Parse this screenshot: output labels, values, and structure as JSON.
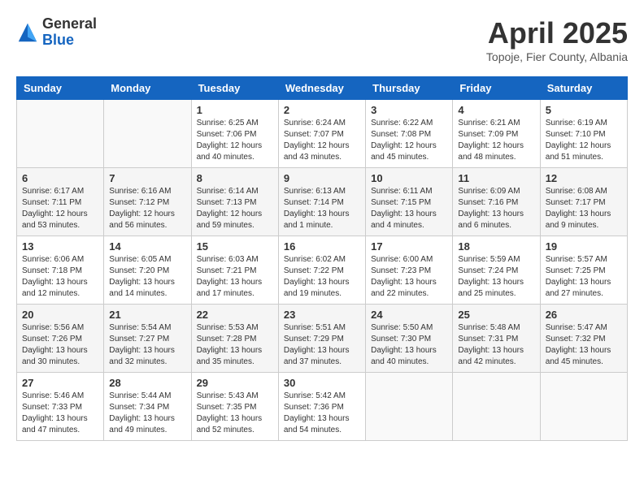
{
  "header": {
    "logo_general": "General",
    "logo_blue": "Blue",
    "month_year": "April 2025",
    "location": "Topoje, Fier County, Albania"
  },
  "days_of_week": [
    "Sunday",
    "Monday",
    "Tuesday",
    "Wednesday",
    "Thursday",
    "Friday",
    "Saturday"
  ],
  "weeks": [
    [
      {
        "day": "",
        "sunrise": "",
        "sunset": "",
        "daylight": ""
      },
      {
        "day": "",
        "sunrise": "",
        "sunset": "",
        "daylight": ""
      },
      {
        "day": "1",
        "sunrise": "Sunrise: 6:25 AM",
        "sunset": "Sunset: 7:06 PM",
        "daylight": "Daylight: 12 hours and 40 minutes."
      },
      {
        "day": "2",
        "sunrise": "Sunrise: 6:24 AM",
        "sunset": "Sunset: 7:07 PM",
        "daylight": "Daylight: 12 hours and 43 minutes."
      },
      {
        "day": "3",
        "sunrise": "Sunrise: 6:22 AM",
        "sunset": "Sunset: 7:08 PM",
        "daylight": "Daylight: 12 hours and 45 minutes."
      },
      {
        "day": "4",
        "sunrise": "Sunrise: 6:21 AM",
        "sunset": "Sunset: 7:09 PM",
        "daylight": "Daylight: 12 hours and 48 minutes."
      },
      {
        "day": "5",
        "sunrise": "Sunrise: 6:19 AM",
        "sunset": "Sunset: 7:10 PM",
        "daylight": "Daylight: 12 hours and 51 minutes."
      }
    ],
    [
      {
        "day": "6",
        "sunrise": "Sunrise: 6:17 AM",
        "sunset": "Sunset: 7:11 PM",
        "daylight": "Daylight: 12 hours and 53 minutes."
      },
      {
        "day": "7",
        "sunrise": "Sunrise: 6:16 AM",
        "sunset": "Sunset: 7:12 PM",
        "daylight": "Daylight: 12 hours and 56 minutes."
      },
      {
        "day": "8",
        "sunrise": "Sunrise: 6:14 AM",
        "sunset": "Sunset: 7:13 PM",
        "daylight": "Daylight: 12 hours and 59 minutes."
      },
      {
        "day": "9",
        "sunrise": "Sunrise: 6:13 AM",
        "sunset": "Sunset: 7:14 PM",
        "daylight": "Daylight: 13 hours and 1 minute."
      },
      {
        "day": "10",
        "sunrise": "Sunrise: 6:11 AM",
        "sunset": "Sunset: 7:15 PM",
        "daylight": "Daylight: 13 hours and 4 minutes."
      },
      {
        "day": "11",
        "sunrise": "Sunrise: 6:09 AM",
        "sunset": "Sunset: 7:16 PM",
        "daylight": "Daylight: 13 hours and 6 minutes."
      },
      {
        "day": "12",
        "sunrise": "Sunrise: 6:08 AM",
        "sunset": "Sunset: 7:17 PM",
        "daylight": "Daylight: 13 hours and 9 minutes."
      }
    ],
    [
      {
        "day": "13",
        "sunrise": "Sunrise: 6:06 AM",
        "sunset": "Sunset: 7:18 PM",
        "daylight": "Daylight: 13 hours and 12 minutes."
      },
      {
        "day": "14",
        "sunrise": "Sunrise: 6:05 AM",
        "sunset": "Sunset: 7:20 PM",
        "daylight": "Daylight: 13 hours and 14 minutes."
      },
      {
        "day": "15",
        "sunrise": "Sunrise: 6:03 AM",
        "sunset": "Sunset: 7:21 PM",
        "daylight": "Daylight: 13 hours and 17 minutes."
      },
      {
        "day": "16",
        "sunrise": "Sunrise: 6:02 AM",
        "sunset": "Sunset: 7:22 PM",
        "daylight": "Daylight: 13 hours and 19 minutes."
      },
      {
        "day": "17",
        "sunrise": "Sunrise: 6:00 AM",
        "sunset": "Sunset: 7:23 PM",
        "daylight": "Daylight: 13 hours and 22 minutes."
      },
      {
        "day": "18",
        "sunrise": "Sunrise: 5:59 AM",
        "sunset": "Sunset: 7:24 PM",
        "daylight": "Daylight: 13 hours and 25 minutes."
      },
      {
        "day": "19",
        "sunrise": "Sunrise: 5:57 AM",
        "sunset": "Sunset: 7:25 PM",
        "daylight": "Daylight: 13 hours and 27 minutes."
      }
    ],
    [
      {
        "day": "20",
        "sunrise": "Sunrise: 5:56 AM",
        "sunset": "Sunset: 7:26 PM",
        "daylight": "Daylight: 13 hours and 30 minutes."
      },
      {
        "day": "21",
        "sunrise": "Sunrise: 5:54 AM",
        "sunset": "Sunset: 7:27 PM",
        "daylight": "Daylight: 13 hours and 32 minutes."
      },
      {
        "day": "22",
        "sunrise": "Sunrise: 5:53 AM",
        "sunset": "Sunset: 7:28 PM",
        "daylight": "Daylight: 13 hours and 35 minutes."
      },
      {
        "day": "23",
        "sunrise": "Sunrise: 5:51 AM",
        "sunset": "Sunset: 7:29 PM",
        "daylight": "Daylight: 13 hours and 37 minutes."
      },
      {
        "day": "24",
        "sunrise": "Sunrise: 5:50 AM",
        "sunset": "Sunset: 7:30 PM",
        "daylight": "Daylight: 13 hours and 40 minutes."
      },
      {
        "day": "25",
        "sunrise": "Sunrise: 5:48 AM",
        "sunset": "Sunset: 7:31 PM",
        "daylight": "Daylight: 13 hours and 42 minutes."
      },
      {
        "day": "26",
        "sunrise": "Sunrise: 5:47 AM",
        "sunset": "Sunset: 7:32 PM",
        "daylight": "Daylight: 13 hours and 45 minutes."
      }
    ],
    [
      {
        "day": "27",
        "sunrise": "Sunrise: 5:46 AM",
        "sunset": "Sunset: 7:33 PM",
        "daylight": "Daylight: 13 hours and 47 minutes."
      },
      {
        "day": "28",
        "sunrise": "Sunrise: 5:44 AM",
        "sunset": "Sunset: 7:34 PM",
        "daylight": "Daylight: 13 hours and 49 minutes."
      },
      {
        "day": "29",
        "sunrise": "Sunrise: 5:43 AM",
        "sunset": "Sunset: 7:35 PM",
        "daylight": "Daylight: 13 hours and 52 minutes."
      },
      {
        "day": "30",
        "sunrise": "Sunrise: 5:42 AM",
        "sunset": "Sunset: 7:36 PM",
        "daylight": "Daylight: 13 hours and 54 minutes."
      },
      {
        "day": "",
        "sunrise": "",
        "sunset": "",
        "daylight": ""
      },
      {
        "day": "",
        "sunrise": "",
        "sunset": "",
        "daylight": ""
      },
      {
        "day": "",
        "sunrise": "",
        "sunset": "",
        "daylight": ""
      }
    ]
  ]
}
